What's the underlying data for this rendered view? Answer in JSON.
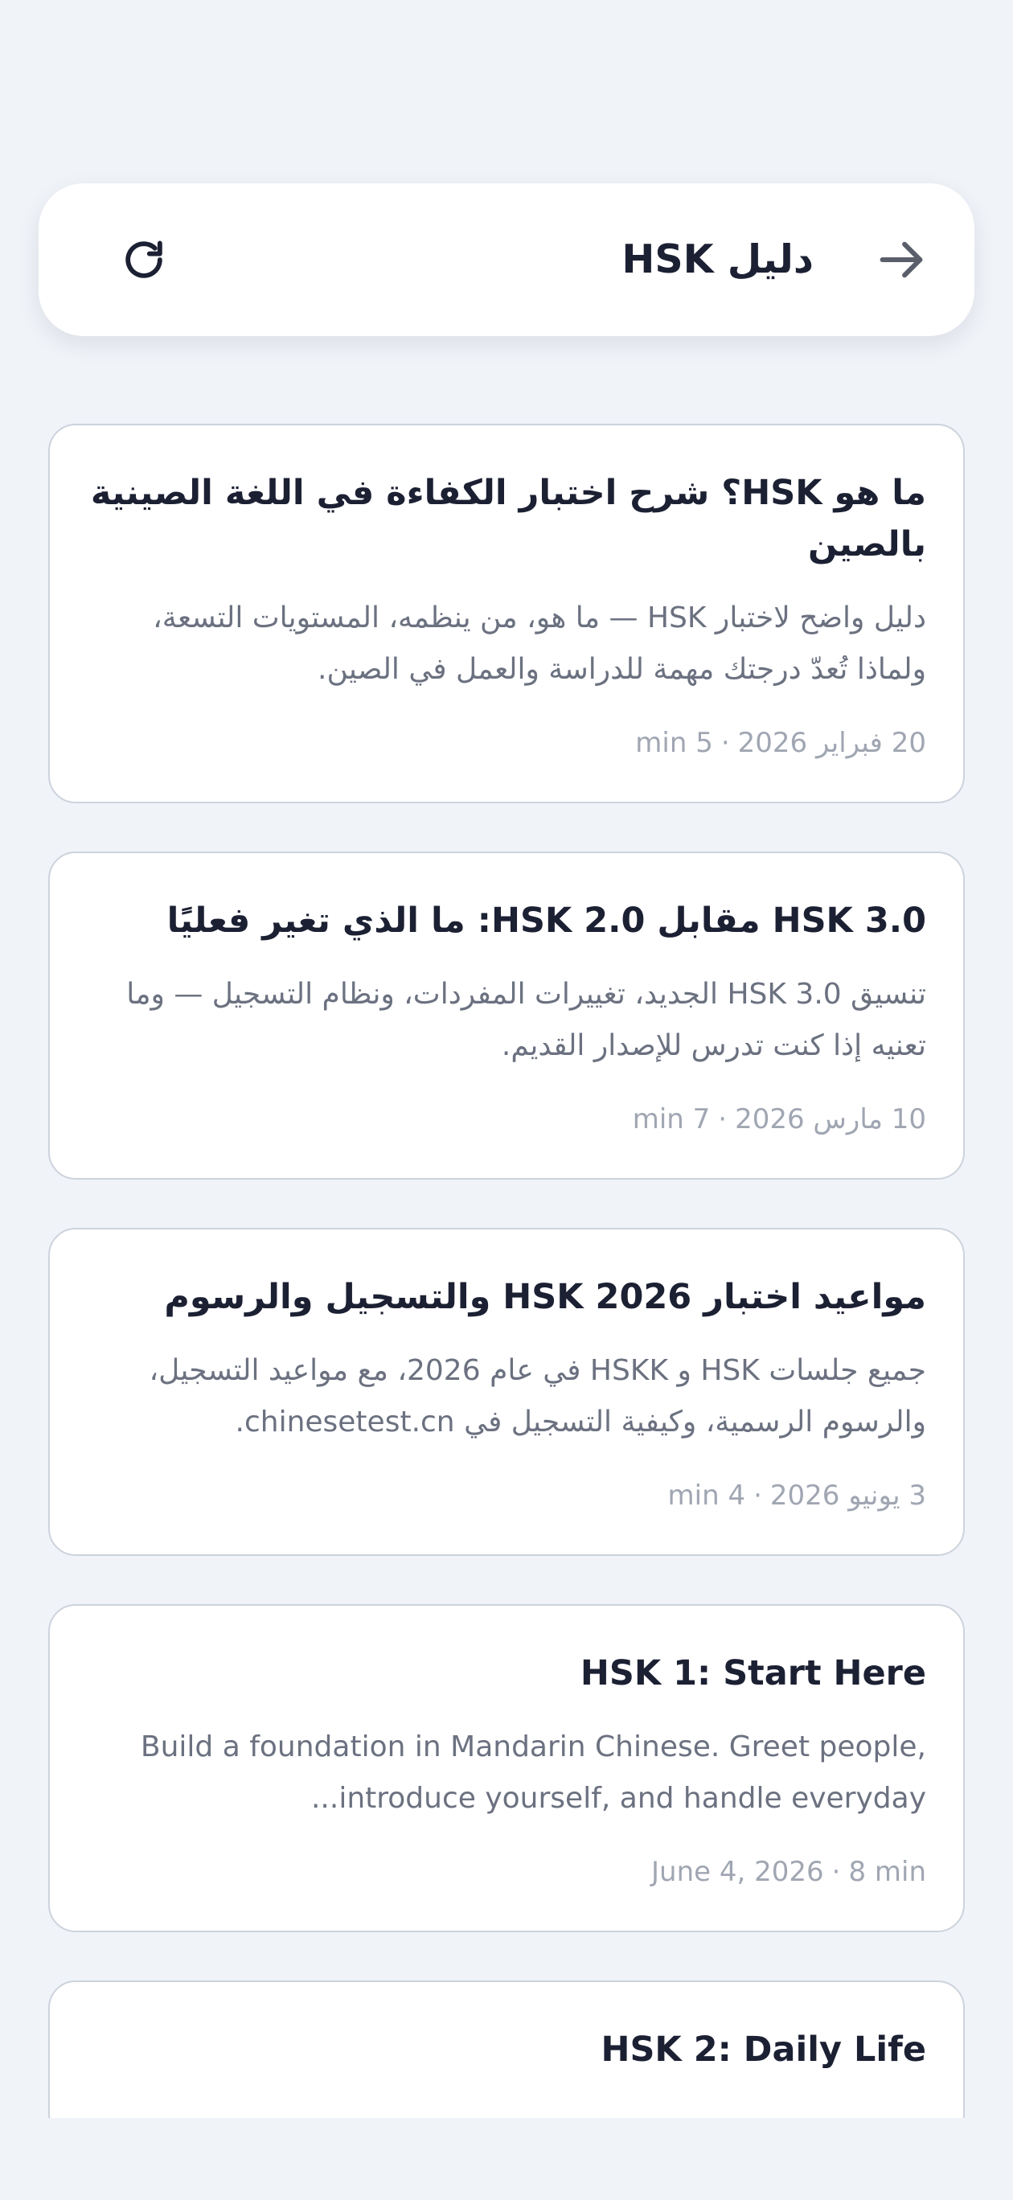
{
  "header": {
    "title": "دليل HSK"
  },
  "icons": {
    "refresh": "refresh-icon",
    "back": "arrow-right-icon"
  },
  "colors": {
    "background": "#f0f3f8",
    "card_border": "#cdd3dd",
    "title_text": "#1c2033",
    "body_text": "#6b7180",
    "meta_text": "#a0a6b2"
  },
  "articles": [
    {
      "title": "ما هو HSK؟ شرح اختبار الكفاءة في اللغة الصينية بالصين",
      "description": "دليل واضح لاختبار HSK — ما هو، من ينظمه، المستويات التسعة، ولماذا تُعدّ درجتك مهمة للدراسة والعمل في الصين.",
      "date": "20 فبراير 2026",
      "read_time": "5 min"
    },
    {
      "title": "HSK 3.0 مقابل HSK 2.0: ما الذي تغير فعليًا",
      "description": "تنسيق HSK 3.0 الجديد، تغييرات المفردات، ونظام التسجيل — وما تعنيه إذا كنت تدرس للإصدار القديم.",
      "date": "10 مارس 2026",
      "read_time": "7 min"
    },
    {
      "title": "مواعيد اختبار HSK 2026 والتسجيل والرسوم",
      "description": "جميع جلسات HSK و HSKK في عام 2026، مع مواعيد التسجيل، والرسوم الرسمية، وكيفية التسجيل في chinesetest.cn.",
      "date": "3 يونيو 2026",
      "read_time": "4 min"
    },
    {
      "title": "HSK 1: Start Here",
      "description": "Build a foundation in Mandarin Chinese. Greet people, introduce yourself, and handle everyday...",
      "date": "June 4, 2026",
      "read_time": "8 min"
    },
    {
      "title": "HSK 2: Daily Life"
    }
  ]
}
